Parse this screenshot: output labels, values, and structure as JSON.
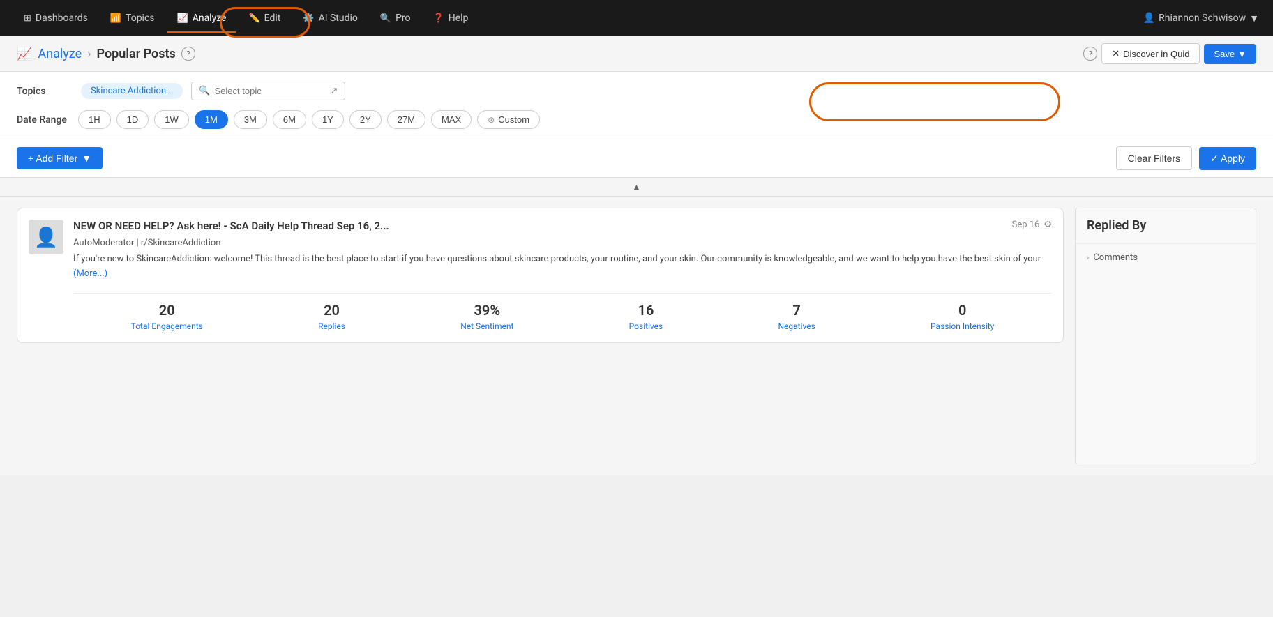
{
  "nav": {
    "items": [
      {
        "label": "Dashboards",
        "icon": "⊞",
        "active": false
      },
      {
        "label": "Topics",
        "icon": "📶",
        "active": false
      },
      {
        "label": "Analyze",
        "icon": "📈",
        "active": true
      },
      {
        "label": "Edit",
        "icon": "✏️",
        "active": false
      },
      {
        "label": "AI Studio",
        "icon": "⚙️",
        "active": false
      },
      {
        "label": "Pro",
        "icon": "🔍",
        "active": false
      },
      {
        "label": "Help",
        "icon": "❓",
        "active": false
      }
    ],
    "user": "Rhiannon Schwisow"
  },
  "subheader": {
    "breadcrumb_icon": "📈",
    "breadcrumb_root": "Analyze",
    "breadcrumb_current": "Popular Posts",
    "discover_label": "Discover in Quid",
    "save_label": "Save"
  },
  "filters": {
    "topics_label": "Topics",
    "topic_tag": "Skincare Addiction...",
    "search_placeholder": "Select topic",
    "date_range_label": "Date Range",
    "date_options": [
      "1H",
      "1D",
      "1W",
      "1M",
      "3M",
      "6M",
      "1Y",
      "2Y",
      "27M",
      "MAX"
    ],
    "active_date": "1M",
    "custom_label": "Custom",
    "add_filter_label": "+ Add Filter",
    "clear_filters_label": "Clear Filters",
    "apply_label": "✓ Apply"
  },
  "post": {
    "title": "NEW OR NEED HELP? Ask here! - ScA Daily Help Thread Sep 16, 2...",
    "date": "Sep 16",
    "author": "AutoModerator | r/SkincareAddiction",
    "body": "If you're new to SkincareAddiction: welcome! This thread is the best place to start if you have questions about skincare products, your routine, and your skin. Our community is knowledgeable, and we want to help you have the best skin of your",
    "more_label": "(More...)",
    "stats": [
      {
        "value": "20",
        "label": "Total Engagements"
      },
      {
        "value": "20",
        "label": "Replies"
      },
      {
        "value": "39%",
        "label": "Net Sentiment"
      },
      {
        "value": "16",
        "label": "Positives"
      },
      {
        "value": "7",
        "label": "Negatives"
      },
      {
        "value": "0",
        "label": "Passion Intensity"
      }
    ]
  },
  "right_panel": {
    "title": "Replied By",
    "comments_label": "Comments"
  }
}
